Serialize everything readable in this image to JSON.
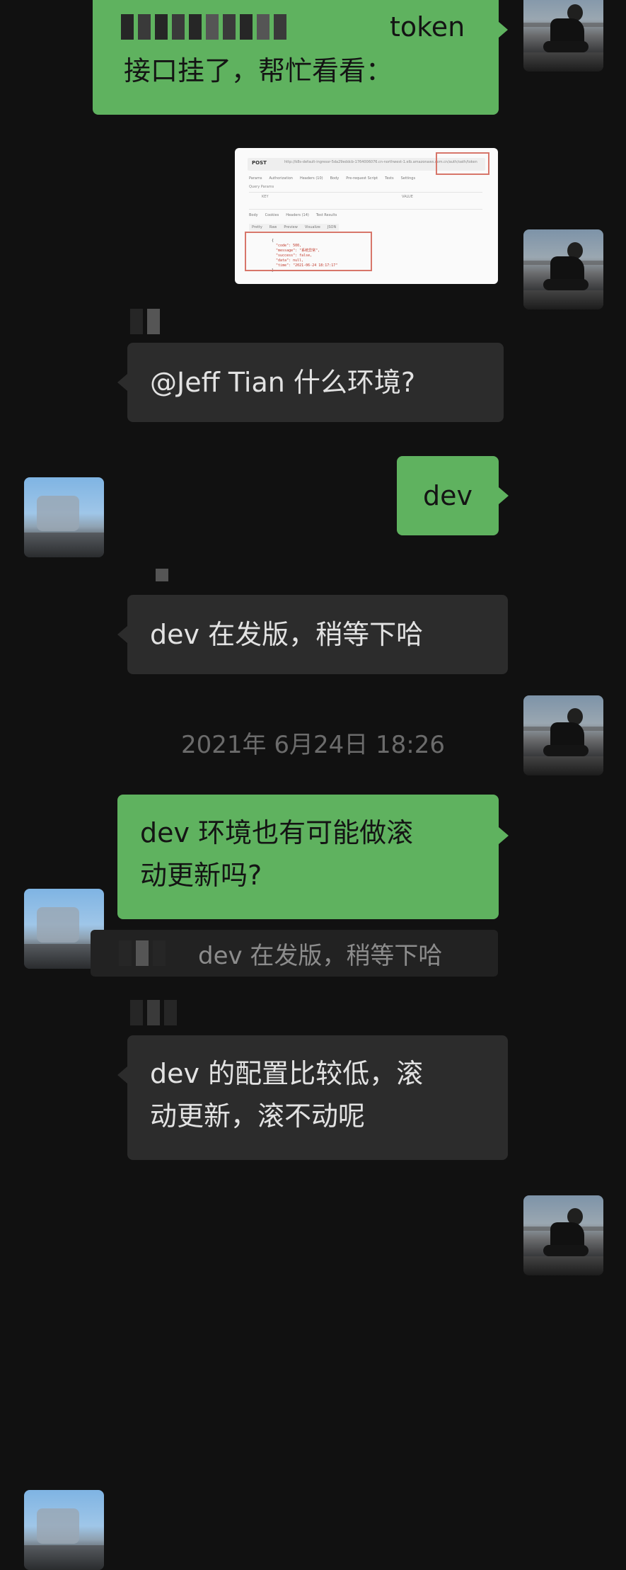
{
  "messages": {
    "m1": {
      "line1_tail": "token",
      "line2": "接口挂了，帮忙看看："
    },
    "m2_screenshot": {
      "method": "POST",
      "url": "http://k8s-default-ingressr-5da29eddcb-1764006076.cn-northwest-1.elb.amazonaws.com.cn/auth/oath/token",
      "tabs": [
        "Params",
        "Authorization",
        "Headers (10)",
        "Body",
        "Pre-request Script",
        "Tests",
        "Settings"
      ],
      "query_params_label": "Query Params",
      "key_label": "KEY",
      "value_label": "VALUE",
      "response_tabs": [
        "Body",
        "Cookies",
        "Headers (14)",
        "Test Results"
      ],
      "view_tabs": [
        "Pretty",
        "Raw",
        "Preview",
        "Visualize",
        "JSON"
      ],
      "code_lines": [
        "{",
        "  \"code\": 500,",
        "  \"message\": \"系统异常\",",
        "  \"success\": false,",
        "  \"data\": null,",
        "  \"time\": \"2021-06-24 18:17:17\"",
        "}"
      ]
    },
    "m3": {
      "text": "@Jeff Tian  什么环境?"
    },
    "m4": {
      "text": "dev"
    },
    "m5": {
      "text": "dev 在发版，稍等下哈"
    },
    "timestamp": "2021年 6月24日 18:26",
    "m6": {
      "line1": "dev 环境也有可能做滚",
      "line2": "动更新吗?"
    },
    "quote": {
      "text": "dev 在发版，稍等下哈"
    },
    "m7": {
      "line1": "dev 的配置比较低，滚",
      "line2": "动更新，滚不动呢"
    }
  },
  "colors": {
    "background": "#111111",
    "my_bubble": "#5fb25f",
    "other_bubble": "#2c2c2c",
    "timestamp": "#6b6b6b",
    "highlight_box": "#d7766a"
  },
  "icons": {
    "self_avatar": "avatar-person-crouching",
    "other_avatar": "avatar-sky-landscape"
  }
}
